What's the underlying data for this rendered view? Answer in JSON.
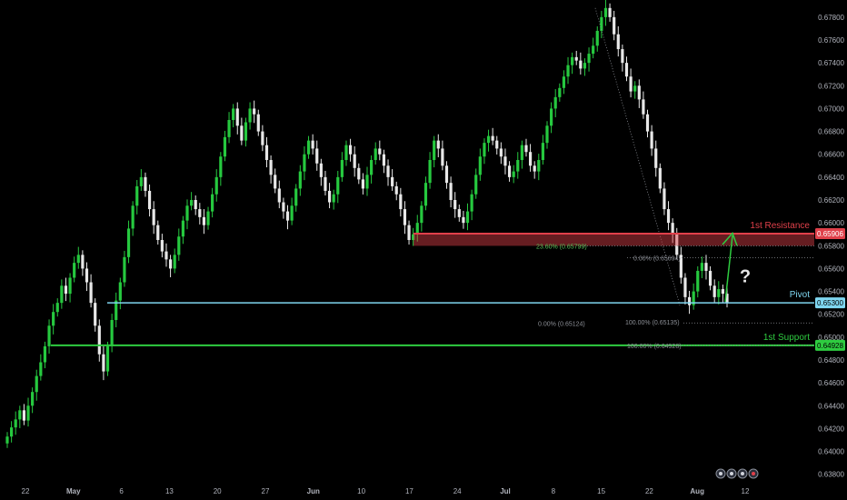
{
  "chart_data": {
    "type": "candlestick",
    "instrument_scale": "price",
    "ylim": [
      0.6375,
      0.6795
    ],
    "y_ticks": [
      "0.67800",
      "0.67600",
      "0.67400",
      "0.67200",
      "0.67000",
      "0.66800",
      "0.66600",
      "0.66400",
      "0.66200",
      "0.66000",
      "0.65800",
      "0.65600",
      "0.65400",
      "0.65200",
      "0.65000",
      "0.64800",
      "0.64600",
      "0.64400",
      "0.64200",
      "0.64000",
      "0.63800"
    ],
    "x_ticks": [
      "22",
      "May",
      "6",
      "13",
      "20",
      "27",
      "Jun",
      "10",
      "17",
      "24",
      "Jul",
      "8",
      "15",
      "22",
      "Aug",
      "12"
    ],
    "x_ticks_bold": [
      "May",
      "Jun",
      "Jul",
      "Aug"
    ],
    "last_bar_label": "Aug",
    "colors": {
      "up": "#26c93f",
      "down": "#e8e8e8",
      "resistance": "#e0404a",
      "pivot": "#7fd6f0",
      "support": "#2ecc40"
    },
    "series_close": [
      0.6413,
      0.6421,
      0.6428,
      0.6436,
      0.6427,
      0.644,
      0.6452,
      0.6466,
      0.6478,
      0.6492,
      0.651,
      0.6522,
      0.653,
      0.6545,
      0.6538,
      0.6552,
      0.6565,
      0.6572,
      0.656,
      0.6548,
      0.653,
      0.651,
      0.6485,
      0.647,
      0.6492,
      0.6515,
      0.6532,
      0.6548,
      0.657,
      0.6595,
      0.6615,
      0.6632,
      0.664,
      0.6628,
      0.6612,
      0.6598,
      0.6585,
      0.6575,
      0.6568,
      0.656,
      0.6572,
      0.6588,
      0.6602,
      0.6615,
      0.662,
      0.6612,
      0.6605,
      0.6598,
      0.661,
      0.6625,
      0.664,
      0.6658,
      0.6675,
      0.669,
      0.67,
      0.6685,
      0.6672,
      0.6688,
      0.67,
      0.6695,
      0.668,
      0.6668,
      0.6655,
      0.6642,
      0.663,
      0.6618,
      0.661,
      0.6602,
      0.6615,
      0.663,
      0.6645,
      0.666,
      0.6672,
      0.6665,
      0.6652,
      0.664,
      0.6628,
      0.6618,
      0.6625,
      0.664,
      0.6655,
      0.6668,
      0.666,
      0.6648,
      0.6638,
      0.663,
      0.6642,
      0.6655,
      0.6665,
      0.666,
      0.665,
      0.664,
      0.6632,
      0.6625,
      0.6612,
      0.6598,
      0.6585,
      0.659,
      0.66,
      0.6615,
      0.6635,
      0.6655,
      0.6672,
      0.6665,
      0.665,
      0.6635,
      0.662,
      0.6612,
      0.6605,
      0.66,
      0.661,
      0.6625,
      0.6642,
      0.6658,
      0.667,
      0.6676,
      0.6672,
      0.6665,
      0.6658,
      0.665,
      0.664,
      0.6645,
      0.6655,
      0.6668,
      0.6662,
      0.665,
      0.6645,
      0.6655,
      0.667,
      0.6685,
      0.67,
      0.671,
      0.6718,
      0.6728,
      0.6738,
      0.6745,
      0.6742,
      0.6735,
      0.674,
      0.6748,
      0.6755,
      0.6768,
      0.678,
      0.6788,
      0.678,
      0.6765,
      0.6752,
      0.674,
      0.6728,
      0.6715,
      0.672,
      0.6708,
      0.6695,
      0.668,
      0.6665,
      0.6648,
      0.663,
      0.6612,
      0.66,
      0.659,
      0.6572,
      0.6552,
      0.6535,
      0.6528,
      0.654,
      0.6558,
      0.6565,
      0.6558,
      0.6545,
      0.6535,
      0.6542,
      0.6538,
      0.653
    ],
    "levels": [
      {
        "name": "1st Resistance",
        "value": 0.65906,
        "tag": "0.65906"
      },
      {
        "name": "Pivot",
        "value": 0.653,
        "tag": "0.65300"
      },
      {
        "name": "1st Support",
        "value": 0.64928,
        "tag": "0.64928"
      }
    ],
    "fib_labels": [
      {
        "text": "23.60% (0.65799)",
        "value": 0.65799
      },
      {
        "text": "0.00% (0.65694)",
        "value": 0.65694
      },
      {
        "text": "0.00% (0.65124)",
        "value": 0.65124
      },
      {
        "text": "100.00% (0.65135)",
        "value": 0.65135
      },
      {
        "text": "100.00% (0.64928)",
        "value": 0.64928
      }
    ],
    "annotation": "?"
  },
  "toolbar": {
    "icons": [
      "camera-icon",
      "share-icon",
      "gear-icon",
      "flag-icon"
    ]
  }
}
